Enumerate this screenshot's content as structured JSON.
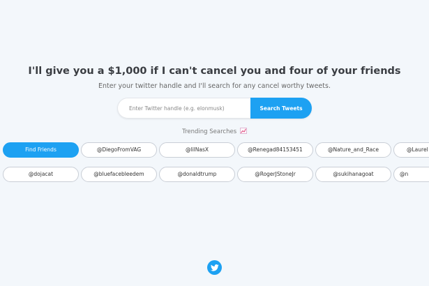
{
  "header": {
    "headline": "I'll give you a $1,000 if I can't cancel you and four of your friends",
    "subheadline": "Enter your twitter handle and I'll search for any cancel worthy tweets."
  },
  "search": {
    "placeholder": "Enter Twitter handle (e.g. elonmusk)",
    "button_label": "Search Tweets"
  },
  "trending": {
    "label": "Trending Searches",
    "icon": "chart-increasing-icon",
    "row1": [
      "Find Friends",
      "@DiegoFromVAG",
      "@lilNasX",
      "@Renegad84153451",
      "@Nature_and_Race",
      "@Laurel"
    ],
    "row2": [
      "@dojacat",
      "@bluefacebleedem",
      "@donaldtrump",
      "@RogerJStoneJr",
      "@sukihanagoat",
      "@n"
    ]
  },
  "footer": {
    "icon": "twitter-icon"
  },
  "colors": {
    "accent": "#1da1f2",
    "background": "#f3f7fb"
  }
}
